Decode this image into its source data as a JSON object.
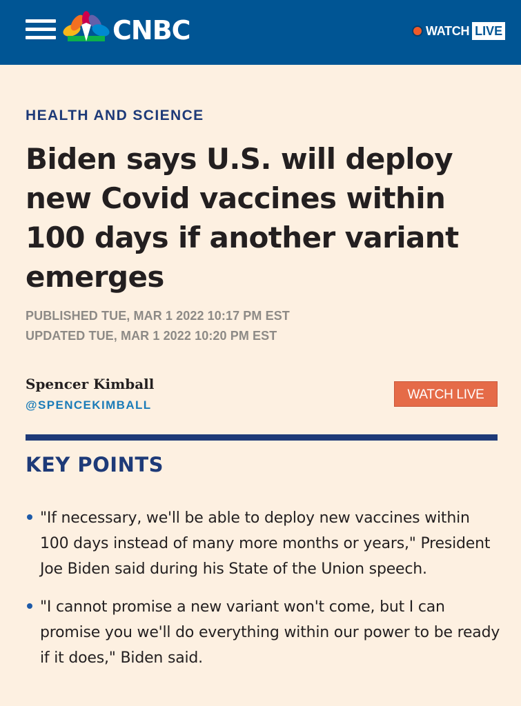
{
  "header": {
    "brand": "CNBC",
    "watch_label": "WATCH",
    "live_label": "LIVE",
    "colors": {
      "bar": "#005594",
      "live_dot": "#f05a28"
    }
  },
  "article": {
    "section": "HEALTH AND SCIENCE",
    "headline": "Biden says U.S. will deploy new Covid vaccines within 100 days if another variant emerges",
    "published": "PUBLISHED TUE, MAR 1 2022 10:17 PM EST",
    "updated": "UPDATED TUE, MAR 1 2022 10:20 PM EST",
    "author": {
      "name": "Spencer Kimball",
      "handle": "@SPENCEKIMBALL"
    },
    "watch_live_button": "WATCH LIVE",
    "key_points": {
      "heading": "KEY POINTS",
      "items": [
        "\"If necessary, we'll be able to deploy new vaccines within 100 days instead of many more months or years,\" President Joe Biden said during his State of the Union speech.",
        "\"I cannot promise a new variant won't come, but I can promise you we'll do everything within our power to be ready if it does,\" Biden said."
      ]
    }
  },
  "icons": [
    "menu-icon",
    "peacock-icon",
    "live-dot-icon",
    "bullet-icon"
  ]
}
